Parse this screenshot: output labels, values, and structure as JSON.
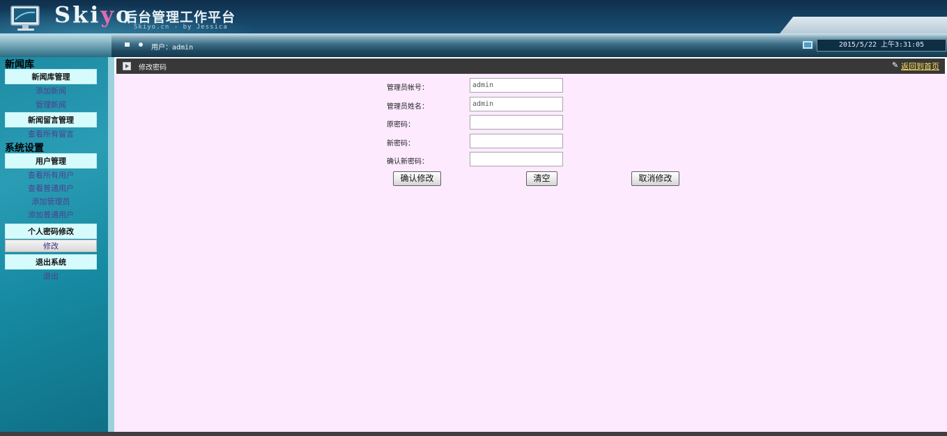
{
  "header": {
    "logo_text_a": "Sk",
    "logo_text_i": "i",
    "logo_text_y": "y",
    "logo_text_o": "o",
    "title": "后台管理工作平台",
    "subtitle": "Skiyo.cn - by Jessica"
  },
  "toolbar": {
    "user_text": "用户：admin",
    "clock": "2015/5/22 上午3:31:05"
  },
  "sidebar": {
    "sections": [
      {
        "title": "新闻库",
        "groups": [
          {
            "heading": "新闻库管理",
            "links": [
              "添加新闻",
              "管理新闻"
            ]
          },
          {
            "heading": "新闻留言管理",
            "links": [
              "查看所有留言"
            ]
          }
        ]
      },
      {
        "title": "系统设置",
        "groups": [
          {
            "heading": "用户管理",
            "links": [
              "查看所有用户",
              "查看普通用户",
              "添加管理员",
              "添加普通用户"
            ]
          },
          {
            "heading": "个人密码修改",
            "links": [
              "修改"
            ]
          },
          {
            "heading": "退出系统",
            "links": [
              "退出"
            ]
          }
        ]
      }
    ]
  },
  "main": {
    "title": "修改密码",
    "back_link": "返回到首页",
    "form": {
      "fields": [
        {
          "label": "管理员帐号：",
          "value": "admin"
        },
        {
          "label": "管理员姓名：",
          "value": "admin"
        },
        {
          "label": "原密码：",
          "value": ""
        },
        {
          "label": "新密码：",
          "value": ""
        },
        {
          "label": "确认新密码：",
          "value": ""
        }
      ],
      "buttons": {
        "confirm": "确认修改",
        "clear": "清空",
        "cancel": "取消修改"
      }
    }
  },
  "colors": {
    "content_bg": "#fdeaff",
    "menu_head_bg": "#d6fbfd",
    "sidebar_bg": "#1d8aa3",
    "back_link": "#ffe05a"
  }
}
